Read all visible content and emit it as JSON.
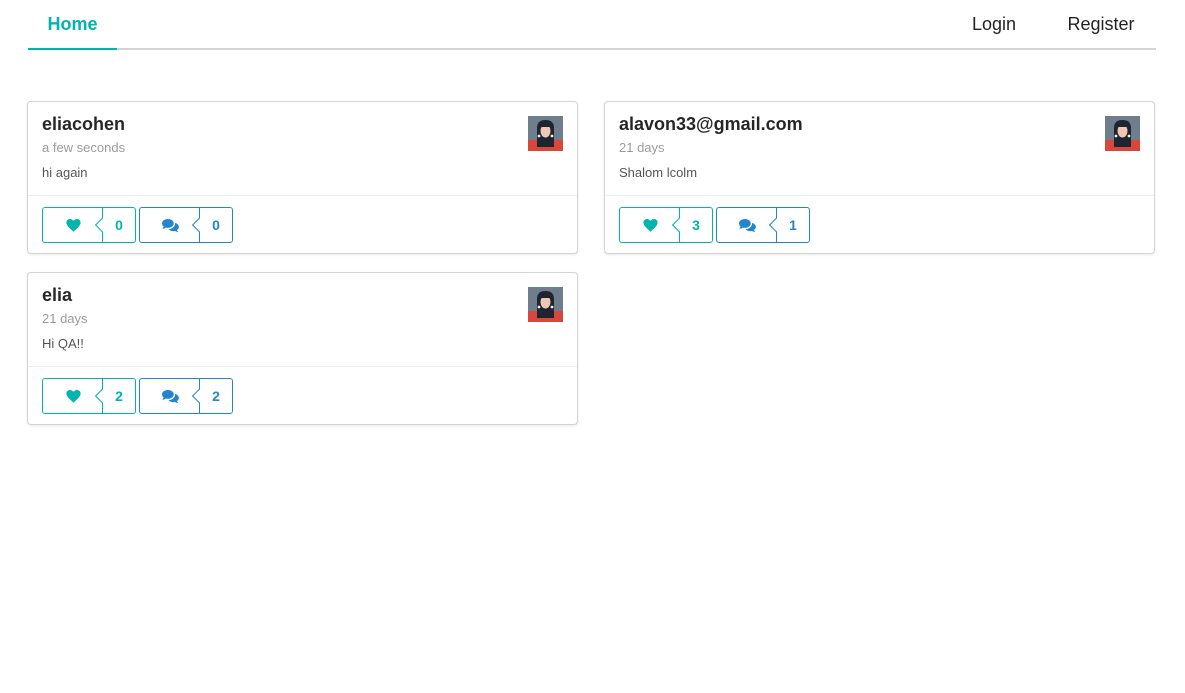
{
  "menu": {
    "home_label": "Home",
    "login_label": "Login",
    "register_label": "Register"
  },
  "posts": [
    {
      "author": "eliacohen",
      "time": "a few seconds",
      "body": "hi again",
      "likes": "0",
      "comments": "0"
    },
    {
      "author": "alavon33@gmail.com",
      "time": "21 days",
      "body": "Shalom lcolm",
      "likes": "3",
      "comments": "1"
    },
    {
      "author": "elia",
      "time": "21 days",
      "body": "Hi QA!!",
      "likes": "2",
      "comments": "2"
    }
  ],
  "icons": {
    "like": "heart-icon",
    "comment": "comments-icon",
    "avatar": "user-avatar"
  },
  "colors": {
    "teal": "#00b5ad",
    "blue": "#2185d0",
    "border": "#d4d4d5"
  }
}
